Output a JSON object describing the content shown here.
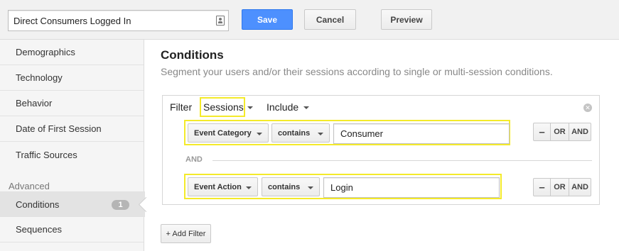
{
  "segment_name": "Direct Consumers Logged In",
  "toolbar": {
    "save_label": "Save",
    "cancel_label": "Cancel",
    "preview_label": "Preview"
  },
  "sidebar": {
    "items": [
      {
        "label": "Demographics"
      },
      {
        "label": "Technology"
      },
      {
        "label": "Behavior"
      },
      {
        "label": "Date of First Session"
      },
      {
        "label": "Traffic Sources"
      }
    ],
    "advanced_heading": "Advanced",
    "advanced_items": [
      {
        "label": "Conditions",
        "badge": "1",
        "active": true
      },
      {
        "label": "Sequences"
      }
    ]
  },
  "main": {
    "title": "Conditions",
    "subtitle": "Segment your users and/or their sessions according to single or multi-session conditions."
  },
  "filter": {
    "label": "Filter",
    "scope": "Sessions",
    "mode": "Include",
    "conditions": [
      {
        "dimension": "Event Category",
        "operator": "contains",
        "value": "Consumer"
      },
      {
        "dimension": "Event Action",
        "operator": "contains",
        "value": "Login"
      }
    ],
    "separator": "AND",
    "bool": {
      "minus": "–",
      "or": "OR",
      "and": "AND"
    }
  },
  "add_filter_label": "+ Add Filter",
  "colors": {
    "save_blue": "#4d90fe",
    "highlight_yellow": "#f4ea2a"
  }
}
